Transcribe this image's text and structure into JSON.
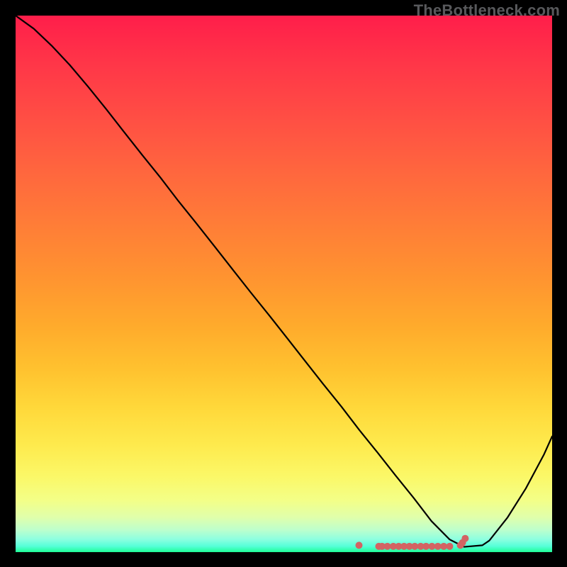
{
  "watermark": "TheBottleneck.com",
  "chart_data": {
    "type": "line",
    "title": "",
    "xlabel": "",
    "ylabel": "",
    "xlim": [
      0,
      100
    ],
    "ylim": [
      0,
      102
    ],
    "grid": false,
    "note": "Axis values not labeled; x/y normalized 0..100. Curve estimated from gridlines/pixels.",
    "series": [
      {
        "name": "curve",
        "color": "#000000",
        "x": [
          0,
          3.4,
          6.7,
          10.1,
          13.5,
          16.9,
          20.2,
          23.6,
          27.0,
          30.3,
          33.7,
          37.1,
          40.4,
          43.8,
          47.2,
          50.6,
          53.9,
          57.3,
          60.7,
          64.0,
          67.4,
          70.8,
          74.2,
          77.5,
          80.9,
          83.6,
          87.0,
          88.3,
          91.7,
          95.1,
          98.5,
          100.0
        ],
        "y": [
          102.0,
          99.5,
          96.3,
          92.6,
          88.5,
          84.2,
          79.9,
          75.5,
          71.2,
          66.8,
          62.5,
          58.1,
          53.8,
          49.4,
          45.1,
          40.7,
          36.4,
          32.0,
          27.7,
          23.3,
          19.0,
          14.6,
          10.3,
          5.9,
          2.4,
          1.0,
          1.3,
          2.2,
          6.6,
          12.1,
          18.6,
          22.0
        ]
      },
      {
        "name": "highlight-dots",
        "color": "#d36363",
        "x": [
          64.0,
          67.7,
          68.3,
          69.3,
          70.4,
          71.4,
          72.4,
          73.4,
          74.4,
          75.5,
          76.5,
          77.6,
          78.7,
          79.8,
          80.9,
          82.9,
          83.3,
          83.8
        ],
        "y": [
          1.3,
          1.1,
          1.1,
          1.1,
          1.1,
          1.1,
          1.1,
          1.1,
          1.1,
          1.1,
          1.1,
          1.1,
          1.1,
          1.1,
          1.1,
          1.3,
          1.8,
          2.6
        ]
      }
    ],
    "background": {
      "type": "vertical-gradient",
      "stops": [
        {
          "pos": 0.0,
          "color": "#ff1e4a"
        },
        {
          "pos": 0.09,
          "color": "#ff3648"
        },
        {
          "pos": 0.19,
          "color": "#ff4e44"
        },
        {
          "pos": 0.29,
          "color": "#ff663e"
        },
        {
          "pos": 0.39,
          "color": "#ff7d37"
        },
        {
          "pos": 0.49,
          "color": "#ff9430"
        },
        {
          "pos": 0.58,
          "color": "#ffab2c"
        },
        {
          "pos": 0.66,
          "color": "#ffc22f"
        },
        {
          "pos": 0.73,
          "color": "#ffd83a"
        },
        {
          "pos": 0.8,
          "color": "#feea4d"
        },
        {
          "pos": 0.86,
          "color": "#fbf868"
        },
        {
          "pos": 0.904,
          "color": "#f3ff88"
        },
        {
          "pos": 0.935,
          "color": "#e0ffab"
        },
        {
          "pos": 0.958,
          "color": "#beffcc"
        },
        {
          "pos": 0.976,
          "color": "#8dffe0"
        },
        {
          "pos": 0.989,
          "color": "#55ffd8"
        },
        {
          "pos": 1.0,
          "color": "#1fff96"
        }
      ]
    }
  }
}
